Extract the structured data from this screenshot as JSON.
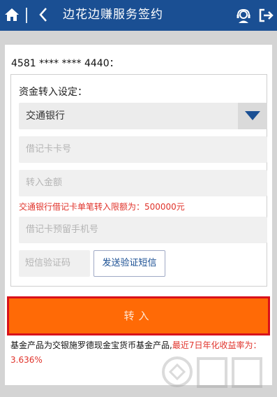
{
  "header": {
    "title": "边花边赚服务签约",
    "home_icon": "home-icon",
    "back_icon": "chevron-left-icon",
    "service_icon": "customer-service-icon",
    "exit_icon": "logout-icon"
  },
  "card": {
    "number": "4581 **** **** 4440："
  },
  "form": {
    "section_title": "资金转入设定：",
    "bank_select_value": "交通银行",
    "card_number_placeholder": "借记卡卡号",
    "amount_placeholder": "转入金额",
    "limit_text": "交通银行借记卡单笔转入限额为：500000元",
    "phone_placeholder": "借记卡预留手机号",
    "sms_code_placeholder": "短信验证码",
    "send_sms_label": "发送验证短信"
  },
  "submit_label": "转入",
  "note": {
    "text_plain": "基金产品为交银施罗德现金宝货币基金产品,",
    "text_red": "最近7日年化收益率为：3.636%"
  },
  "colors": {
    "header_bg": "#1a4f93",
    "submit_bg": "#ff6a06",
    "submit_border": "#d8111b",
    "warning_text": "#e0322a"
  }
}
